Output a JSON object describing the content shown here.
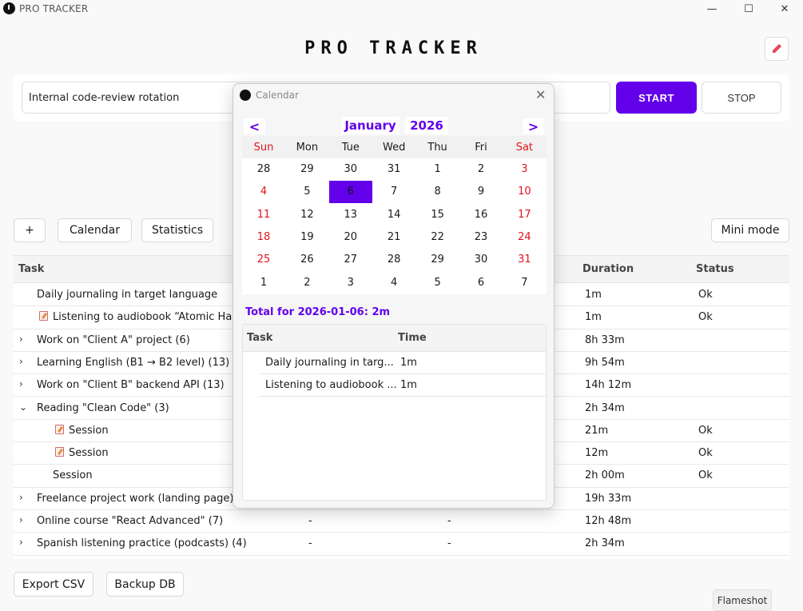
{
  "app": {
    "name": "PRO TRACKER",
    "title": "PRO TRACKER"
  },
  "window_controls": {
    "minimize": "—",
    "maximize": "☐",
    "close": "✕"
  },
  "entry": {
    "task_value": "Internal code-review rotation",
    "start_label": "START",
    "stop_label": "STOP"
  },
  "toolbar": {
    "add_label": "+",
    "calendar_label": "Calendar",
    "statistics_label": "Statistics",
    "mini_mode_label": "Mini mode"
  },
  "table": {
    "headers": {
      "task": "Task",
      "duration": "Duration",
      "status": "Status"
    },
    "rows": [
      {
        "chevron": "",
        "icon": false,
        "indent": 0,
        "task": "Daily journaling in target language",
        "c2": "",
        "c3": "",
        "duration": "1m",
        "status": "Ok"
      },
      {
        "chevron": "",
        "icon": true,
        "indent": 0,
        "task": "Listening to audiobook “Atomic Habit",
        "c2": "",
        "c3": "",
        "duration": "1m",
        "status": "Ok"
      },
      {
        "chevron": "›",
        "icon": false,
        "indent": 0,
        "task": "Work on \"Client A\" project (6)",
        "c2": "",
        "c3": "",
        "duration": "8h 33m",
        "status": ""
      },
      {
        "chevron": "›",
        "icon": false,
        "indent": 0,
        "task": "Learning English (B1 → B2 level) (13)",
        "c2": "",
        "c3": "",
        "duration": "9h 54m",
        "status": ""
      },
      {
        "chevron": "›",
        "icon": false,
        "indent": 0,
        "task": "Work on \"Client B\" backend API (13)",
        "c2": "",
        "c3": "",
        "duration": "14h 12m",
        "status": ""
      },
      {
        "chevron": "⌄",
        "icon": false,
        "indent": 0,
        "task": "Reading \"Clean Code\" (3)",
        "c2": "",
        "c3": "",
        "duration": "2h 34m",
        "status": ""
      },
      {
        "chevron": "",
        "icon": true,
        "indent": 1,
        "task": "Session",
        "c2": "",
        "c3": "",
        "duration": "21m",
        "status": "Ok"
      },
      {
        "chevron": "",
        "icon": true,
        "indent": 1,
        "task": "Session",
        "c2": "",
        "c3": "",
        "duration": "12m",
        "status": "Ok"
      },
      {
        "chevron": "",
        "icon": false,
        "indent": 1,
        "task": "Session",
        "c2": "",
        "c3": "",
        "duration": "2h 00m",
        "status": "Ok"
      },
      {
        "chevron": "›",
        "icon": false,
        "indent": 0,
        "task": "Freelance project work (landing page) (",
        "c2": "",
        "c3": "",
        "duration": "19h 33m",
        "status": ""
      },
      {
        "chevron": "›",
        "icon": false,
        "indent": 0,
        "task": "Online course \"React Advanced\" (7)",
        "c2": "-",
        "c3": "-",
        "duration": "12h 48m",
        "status": ""
      },
      {
        "chevron": "›",
        "icon": false,
        "indent": 0,
        "task": "Spanish listening practice (podcasts) (4)",
        "c2": "-",
        "c3": "-",
        "duration": "2h 34m",
        "status": ""
      }
    ]
  },
  "bottom": {
    "export_label": "Export CSV",
    "backup_label": "Backup DB"
  },
  "flameshot_label": "Flameshot",
  "calendar": {
    "window_title": "Calendar",
    "close": "✕",
    "prev": "<",
    "next": ">",
    "month": "January",
    "year": "2026",
    "weekdays": [
      "Sun",
      "Mon",
      "Tue",
      "Wed",
      "Thu",
      "Fri",
      "Sat"
    ],
    "weeks": [
      [
        "28",
        "29",
        "30",
        "31",
        "1",
        "2",
        "3"
      ],
      [
        "4",
        "5",
        "6",
        "7",
        "8",
        "9",
        "10"
      ],
      [
        "11",
        "12",
        "13",
        "14",
        "15",
        "16",
        "17"
      ],
      [
        "18",
        "19",
        "20",
        "21",
        "22",
        "23",
        "24"
      ],
      [
        "25",
        "26",
        "27",
        "28",
        "29",
        "30",
        "31"
      ],
      [
        "1",
        "2",
        "3",
        "4",
        "5",
        "6",
        "7"
      ]
    ],
    "selected_date": "2026-01-06",
    "total_text": "Total for 2026-01-06: 2m",
    "table_headers": {
      "task": "Task",
      "time": "Time"
    },
    "entries": [
      {
        "task": "Daily journaling in targ...",
        "time": "1m"
      },
      {
        "task": "Listening to audiobook ...",
        "time": "1m"
      }
    ],
    "accent_color": "#6200ea",
    "weekend_color": "#e0131a"
  },
  "colors": {
    "accent": "#6200ea",
    "background": "#f9f9f9"
  }
}
